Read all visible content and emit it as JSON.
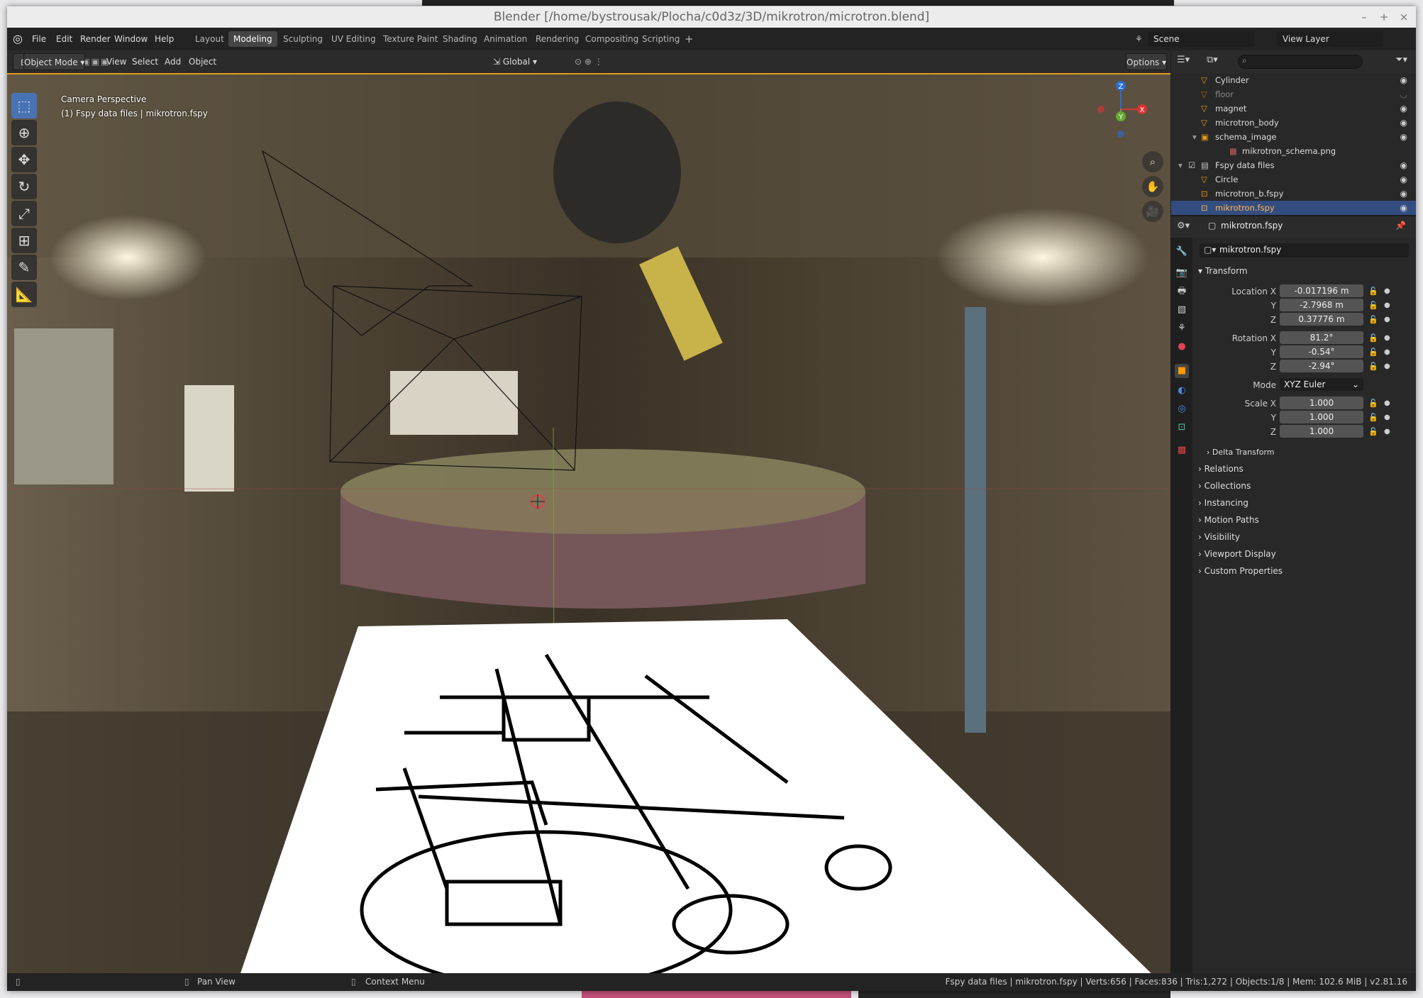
{
  "window": {
    "title": "Blender [/home/bystrousak/Plocha/c0d3z/3D/mikrotron/microtron.blend]",
    "controls": {
      "minimize": "–",
      "maximize": "+",
      "close": "×"
    }
  },
  "menu": [
    "File",
    "Edit",
    "Render",
    "Window",
    "Help"
  ],
  "workspaces": [
    "Layout",
    "Modeling",
    "Sculpting",
    "UV Editing",
    "Texture Paint",
    "Shading",
    "Animation",
    "Rendering",
    "Compositing",
    "Scripting"
  ],
  "active_workspace": "Modeling",
  "add_workspace": "+",
  "scene": {
    "name": "Scene",
    "view_layer": "View Layer"
  },
  "header3d": {
    "mode": "Object Mode",
    "menus": [
      "View",
      "Select",
      "Add",
      "Object"
    ],
    "orientation": "Global",
    "options": "Options"
  },
  "viewport": {
    "camera_label": "Camera Perspective",
    "object_label": "(1) Fspy data files | mikrotron.fspy",
    "gizmo": {
      "x": "X",
      "y": "Y",
      "z": "Z"
    }
  },
  "outliner": {
    "search_placeholder": "",
    "rows": [
      {
        "name": "Cylinder",
        "icon": "mesh-object-icon",
        "selected": false
      },
      {
        "name": "floor",
        "icon": "mesh-object-icon",
        "selected": false
      },
      {
        "name": "magnet",
        "icon": "mesh-object-icon",
        "selected": false
      },
      {
        "name": "microtron_body",
        "icon": "mesh-object-icon",
        "selected": false
      },
      {
        "name": "schema_image",
        "icon": "image-object-icon",
        "selected": false
      },
      {
        "name": "mikrotron_schema.png",
        "icon": "image-icon",
        "selected": false
      },
      {
        "name": "Fspy data files",
        "icon": "collection-icon",
        "selected": false
      },
      {
        "name": "Circle",
        "icon": "mesh-object-icon",
        "selected": false
      },
      {
        "name": "microtron_b.fspy",
        "icon": "camera-object-icon",
        "selected": false
      },
      {
        "name": "mikrotron.fspy",
        "icon": "camera-object-icon",
        "selected": true
      }
    ]
  },
  "properties": {
    "header_object": "mikrotron.fspy",
    "object_name": "mikrotron.fspy",
    "transform_label": "Transform",
    "location": {
      "label_x": "Location X",
      "label_y": "Y",
      "label_z": "Z",
      "x": "-0.017196 m",
      "y": "-2.7968 m",
      "z": "0.37776 m"
    },
    "rotation": {
      "label_x": "Rotation X",
      "label_y": "Y",
      "label_z": "Z",
      "x": "81.2°",
      "y": "-0.54°",
      "z": "-2.94°"
    },
    "mode": {
      "label": "Mode",
      "value": "XYZ Euler"
    },
    "scale": {
      "label_x": "Scale X",
      "label_y": "Y",
      "label_z": "Z",
      "x": "1.000",
      "y": "1.000",
      "z": "1.000"
    },
    "delta_transform": "Delta Transform",
    "panels": [
      "Relations",
      "Collections",
      "Instancing",
      "Motion Paths",
      "Visibility",
      "Viewport Display",
      "Custom Properties"
    ]
  },
  "statusbar": {
    "pan_view": "Pan View",
    "context_menu": "Context Menu",
    "info": "Fspy data files | mikrotron.fspy | Verts:656 | Faces:836 | Tris:1,272 | Objects:1/8 | Mem: 102.6 MiB | v2.81.16"
  }
}
